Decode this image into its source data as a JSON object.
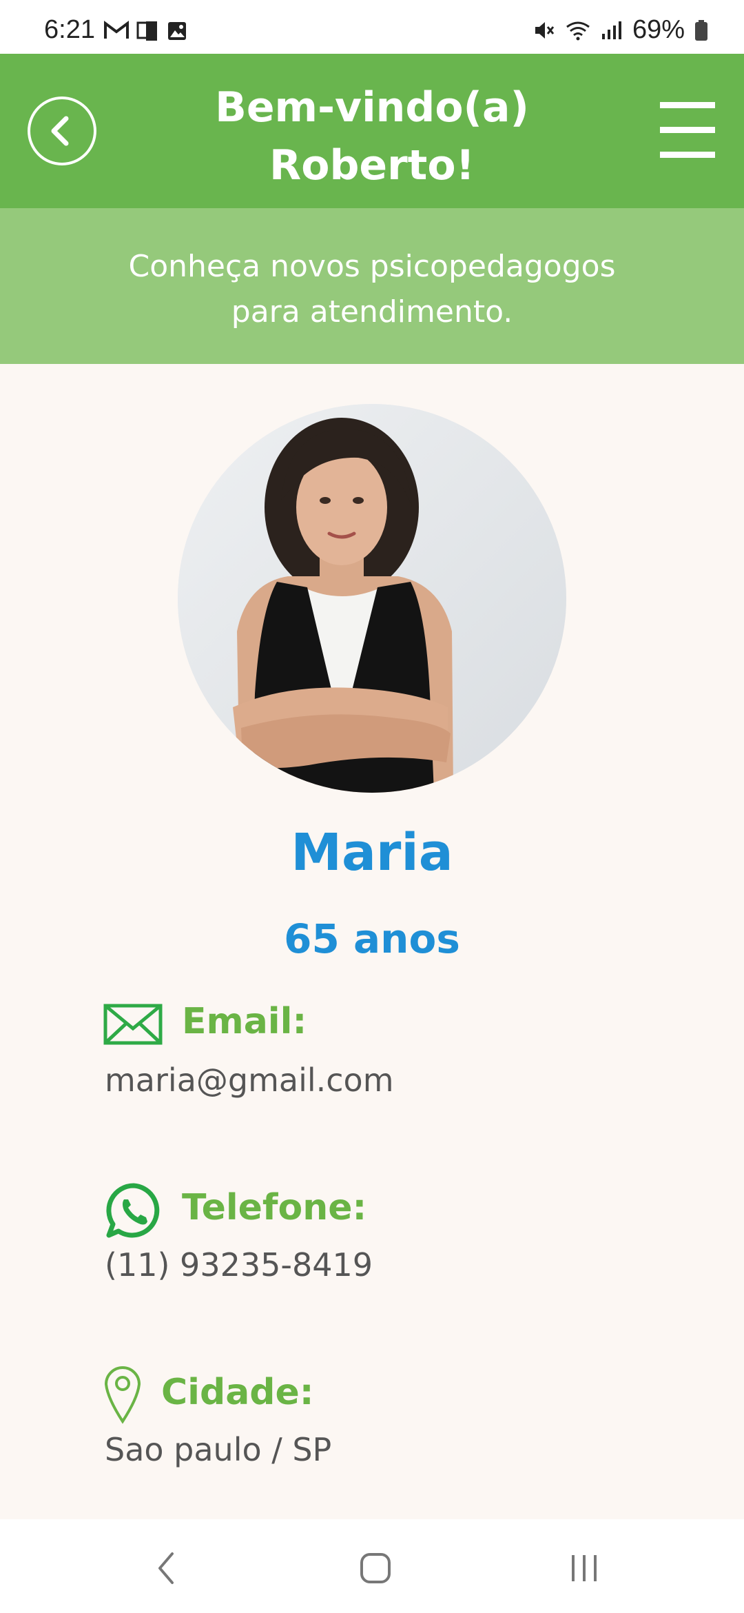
{
  "status_bar": {
    "time": "6:21",
    "battery": "69%"
  },
  "header": {
    "title_line1": "Bem-vindo(a)",
    "title_line2": "Roberto!"
  },
  "banner": {
    "line1": "Conheça novos psicopedagogos",
    "line2": "para atendimento."
  },
  "profile": {
    "name": "Maria",
    "age": "65 anos"
  },
  "contact": {
    "email_label": "Email:",
    "email_value": "maria@gmail.com",
    "phone_label": "Telefone:",
    "phone_value": "(11) 93235-8419",
    "city_label": "Cidade:",
    "city_value": "Sao paulo / SP"
  },
  "colors": {
    "appbar": "#69b54e",
    "banner": "#95c97b",
    "name_blue": "#1f8fd6",
    "label_green": "#6ab445",
    "background": "#fcf7f3"
  },
  "icons": [
    "back-icon",
    "menu-icon",
    "mail-icon",
    "whatsapp-icon",
    "location-pin-icon"
  ]
}
